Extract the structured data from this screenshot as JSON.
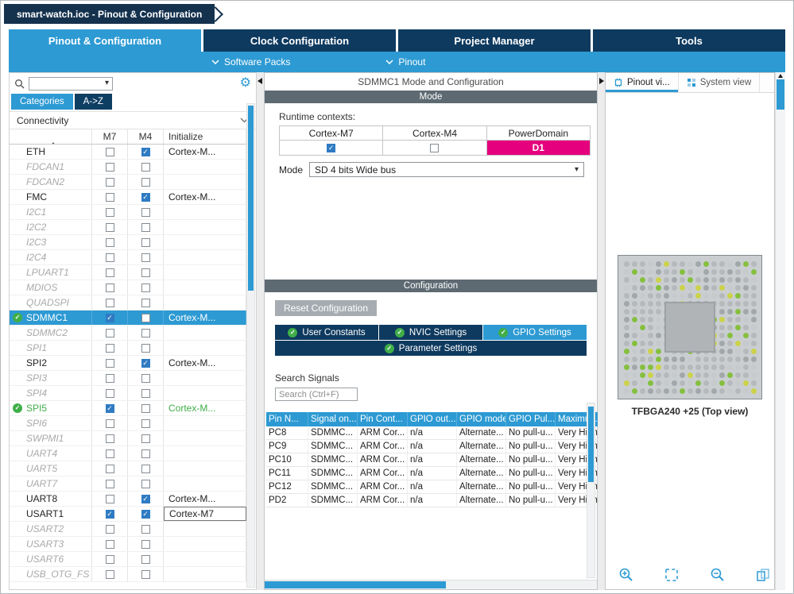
{
  "icons": {
    "gear": "⚙",
    "dropdown": "▾"
  },
  "window": {
    "title": "smart-watch.ioc - Pinout & Configuration"
  },
  "main_tabs": [
    {
      "label": "Pinout & Configuration"
    },
    {
      "label": "Clock Configuration"
    },
    {
      "label": "Project Manager"
    },
    {
      "label": "Tools"
    }
  ],
  "subnav": {
    "software_packs": "Software Packs",
    "pinout": "Pinout"
  },
  "left_panel": {
    "search_value": "",
    "tabs": [
      {
        "label": "Categories"
      },
      {
        "label": "A->Z"
      }
    ],
    "section": "Connectivity",
    "table_headers": [
      "",
      "M7",
      "M4",
      "Initialize"
    ],
    "peripherals": [
      {
        "name": "ETH",
        "state": "",
        "m7": false,
        "m4": true,
        "init": "Cortex-M..."
      },
      {
        "name": "FDCAN1",
        "state": "dis",
        "m7": false,
        "m4": false,
        "init": ""
      },
      {
        "name": "FDCAN2",
        "state": "dis",
        "m7": false,
        "m4": false,
        "init": ""
      },
      {
        "name": "FMC",
        "state": "",
        "m7": false,
        "m4": true,
        "init": "Cortex-M..."
      },
      {
        "name": "I2C1",
        "state": "dis",
        "m7": false,
        "m4": false,
        "init": ""
      },
      {
        "name": "I2C2",
        "state": "dis",
        "m7": false,
        "m4": false,
        "init": ""
      },
      {
        "name": "I2C3",
        "state": "dis",
        "m7": false,
        "m4": false,
        "init": ""
      },
      {
        "name": "I2C4",
        "state": "dis",
        "m7": false,
        "m4": false,
        "init": ""
      },
      {
        "name": "LPUART1",
        "state": "dis",
        "m7": false,
        "m4": false,
        "init": ""
      },
      {
        "name": "MDIOS",
        "state": "dis",
        "m7": false,
        "m4": false,
        "init": ""
      },
      {
        "name": "QUADSPI",
        "state": "dis",
        "m7": false,
        "m4": false,
        "init": ""
      },
      {
        "name": "SDMMC1",
        "state": "sel",
        "check": true,
        "m7": true,
        "m4": false,
        "init": "Cortex-M..."
      },
      {
        "name": "SDMMC2",
        "state": "dis",
        "m7": false,
        "m4": false,
        "init": ""
      },
      {
        "name": "SPI1",
        "state": "dis",
        "m7": false,
        "m4": false,
        "init": ""
      },
      {
        "name": "SPI2",
        "state": "",
        "m7": false,
        "m4": true,
        "init": "Cortex-M..."
      },
      {
        "name": "SPI3",
        "state": "dis",
        "m7": false,
        "m4": false,
        "init": ""
      },
      {
        "name": "SPI4",
        "state": "dis",
        "m7": false,
        "m4": false,
        "init": ""
      },
      {
        "name": "SPI5",
        "state": "grn",
        "check": true,
        "m7": true,
        "m4": false,
        "init": "Cortex-M..."
      },
      {
        "name": "SPI6",
        "state": "dis",
        "m7": false,
        "m4": false,
        "init": ""
      },
      {
        "name": "SWPMI1",
        "state": "dis",
        "m7": false,
        "m4": false,
        "init": ""
      },
      {
        "name": "UART4",
        "state": "dis",
        "m7": false,
        "m4": false,
        "init": ""
      },
      {
        "name": "UART5",
        "state": "dis",
        "m7": false,
        "m4": false,
        "init": ""
      },
      {
        "name": "UART7",
        "state": "dis",
        "m7": false,
        "m4": false,
        "init": ""
      },
      {
        "name": "UART8",
        "state": "",
        "m7": false,
        "m4": true,
        "init": "Cortex-M..."
      },
      {
        "name": "USART1",
        "state": "",
        "m7": true,
        "m4": true,
        "init": "Cortex-M7",
        "boxed": true
      },
      {
        "name": "USART2",
        "state": "dis",
        "m7": false,
        "m4": false,
        "init": ""
      },
      {
        "name": "USART3",
        "state": "dis",
        "m7": false,
        "m4": false,
        "init": ""
      },
      {
        "name": "USART6",
        "state": "dis",
        "m7": false,
        "m4": false,
        "init": ""
      },
      {
        "name": "USB_OTG_FS",
        "state": "dis",
        "m7": false,
        "m4": false,
        "init": ""
      }
    ]
  },
  "middle_panel": {
    "title": "SDMMC1 Mode and Configuration",
    "mode": {
      "header": "Mode",
      "runtime_label": "Runtime contexts:",
      "context_headers": [
        "Cortex-M7",
        "Cortex-M4",
        "PowerDomain"
      ],
      "m7_checked": true,
      "m4_checked": false,
      "power_domain": "D1",
      "mode_label": "Mode",
      "mode_value": "SD 4 bits Wide bus"
    },
    "config": {
      "header": "Configuration",
      "reset_button": "Reset Configuration",
      "tabs": [
        {
          "label": "User Constants"
        },
        {
          "label": "NVIC Settings"
        },
        {
          "label": "GPIO Settings"
        },
        {
          "label": "Parameter Settings"
        }
      ],
      "search_label": "Search Signals",
      "search_placeholder": "Search (Ctrl+F)",
      "gpio_table": {
        "headers": [
          "Pin N...",
          "Signal on...",
          "Pin Cont...",
          "GPIO out...",
          "GPIO mode",
          "GPIO Pul...",
          "Maximu..."
        ],
        "rows": [
          [
            "PC8",
            "SDMMC...",
            "ARM Cor...",
            "n/a",
            "Alternate...",
            "No pull-u...",
            "Very High"
          ],
          [
            "PC9",
            "SDMMC...",
            "ARM Cor...",
            "n/a",
            "Alternate...",
            "No pull-u...",
            "Very High"
          ],
          [
            "PC10",
            "SDMMC...",
            "ARM Cor...",
            "n/a",
            "Alternate...",
            "No pull-u...",
            "Very High"
          ],
          [
            "PC11",
            "SDMMC...",
            "ARM Cor...",
            "n/a",
            "Alternate...",
            "No pull-u...",
            "Very High"
          ],
          [
            "PC12",
            "SDMMC...",
            "ARM Cor...",
            "n/a",
            "Alternate...",
            "No pull-u...",
            "Very High"
          ],
          [
            "PD2",
            "SDMMC...",
            "ARM Cor...",
            "n/a",
            "Alternate...",
            "No pull-u...",
            "Very High"
          ]
        ]
      }
    }
  },
  "right_panel": {
    "tabs": [
      {
        "label": "Pinout vi..."
      },
      {
        "label": "System view"
      }
    ],
    "chip": {
      "label": "TFBGA240 +25 (Top view)",
      "dot_colors": [
        "#b6b9bb",
        "#a2a7aa",
        "#86bf3f",
        "#ccd24a",
        "#c7cacc"
      ]
    }
  },
  "colors": {
    "accent_blue": "#2d9ad3",
    "navy": "#0e3a5f",
    "magenta": "#e5007d",
    "green": "#3fae49",
    "gray_bar": "#5e6a72"
  }
}
